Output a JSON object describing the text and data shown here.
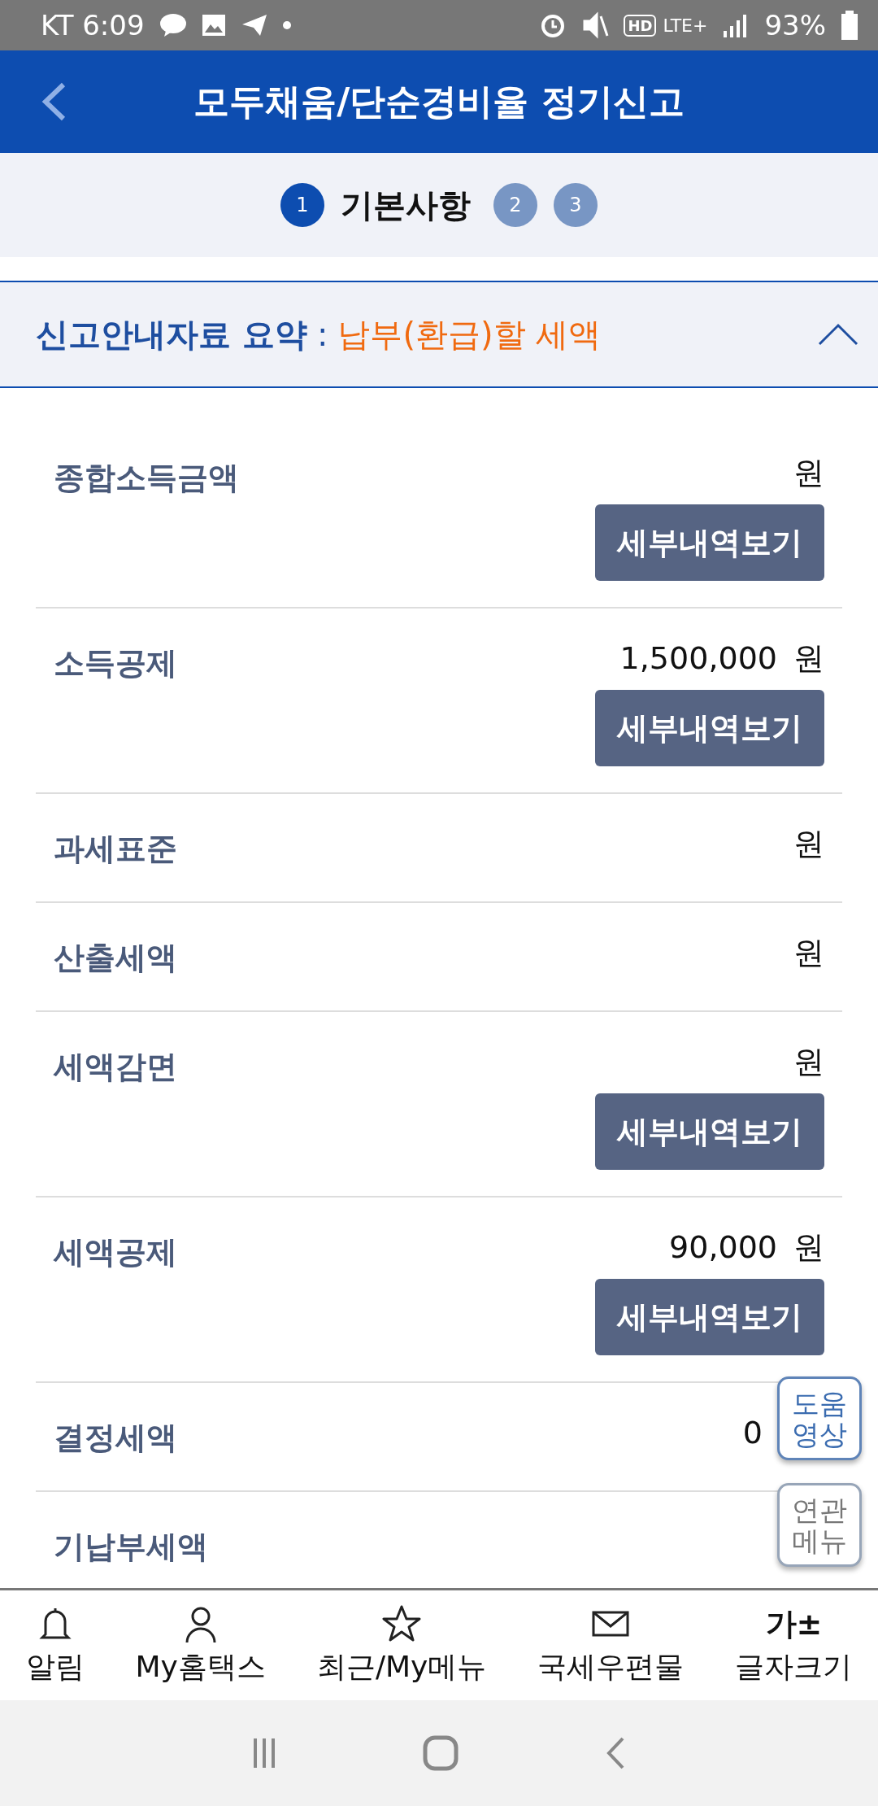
{
  "status_bar": {
    "carrier_time": "KT 6:09",
    "hd": "HD",
    "network": "LTE+",
    "battery": "93%"
  },
  "header": {
    "title": "모두채움/단순경비율 정기신고"
  },
  "steps": [
    {
      "number": "1",
      "label": "기본사항",
      "selected": true
    },
    {
      "number": "2",
      "selected": false
    },
    {
      "number": "3",
      "selected": false
    }
  ],
  "summary": {
    "title": "신고안내자료 요약",
    "separator": ":",
    "highlight": "납부(환급)할 세액",
    "expanded": true
  },
  "rows": [
    {
      "label": "종합소득금액",
      "unit": "원",
      "button": "세부내역보기"
    },
    {
      "label": "소득공제",
      "value": "1,500,000",
      "unit": "원",
      "button": "세부내역보기"
    },
    {
      "label": "과세표준",
      "unit": "원"
    },
    {
      "label": "산출세액",
      "unit": "원"
    },
    {
      "label": "세액감면",
      "unit": "원",
      "button": "세부내역보기"
    },
    {
      "label": "세액공제",
      "value": "90,000",
      "unit": "원",
      "button": "세부내역보기"
    },
    {
      "label": "결정세액",
      "value": "0"
    },
    {
      "label": "기납부세액"
    }
  ],
  "floating_buttons": [
    {
      "label": "도움\n영상",
      "kind": "primary"
    },
    {
      "label": "연관\n메뉴",
      "kind": "secondary"
    }
  ],
  "bottom_nav": [
    {
      "kind": "bell",
      "label": "알림"
    },
    {
      "kind": "person",
      "label": "My홈택스"
    },
    {
      "kind": "star",
      "label": "최근/My메뉴"
    },
    {
      "kind": "mail",
      "label": "국세우편물"
    },
    {
      "kind": "text",
      "icon_text": "가±",
      "label": "글자크기"
    }
  ]
}
